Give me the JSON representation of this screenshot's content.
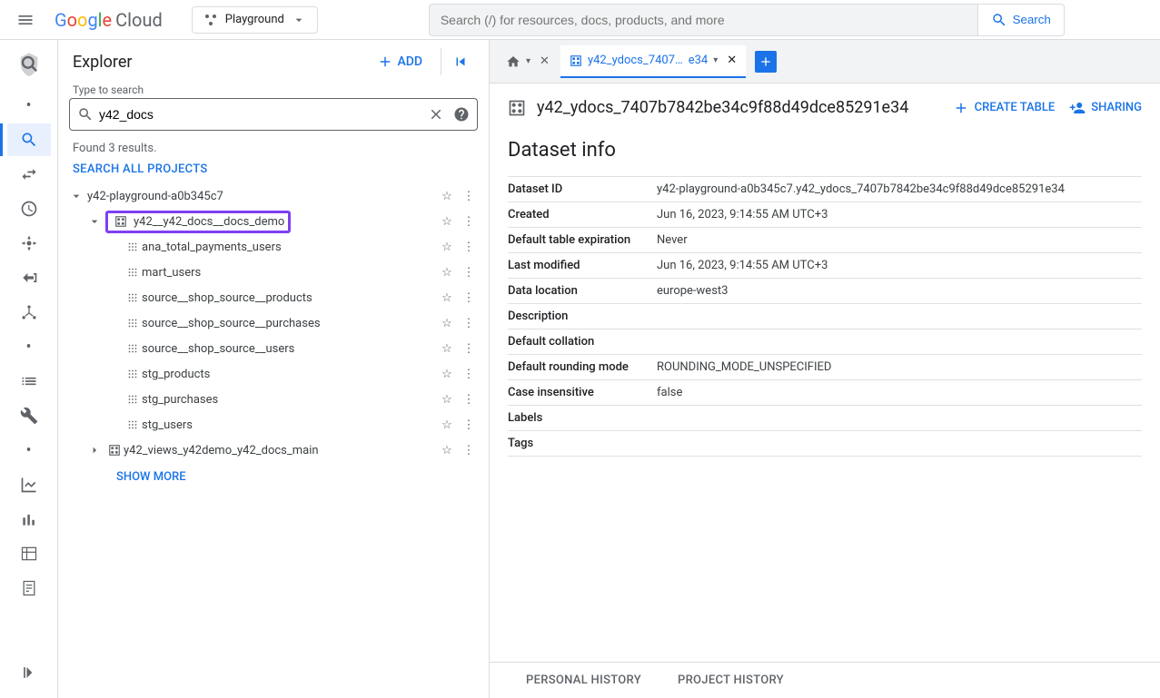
{
  "header": {
    "logo_google": "Google",
    "logo_cloud": "Cloud",
    "project_name": "Playground",
    "search_placeholder": "Search (/) for resources, docs, products, and more",
    "search_button": "Search"
  },
  "explorer": {
    "title": "Explorer",
    "add_button": "ADD",
    "search_label": "Type to search",
    "search_value": "y42_docs",
    "results_text": "Found 3 results.",
    "search_all": "SEARCH ALL PROJECTS",
    "show_more": "SHOW MORE",
    "tree": {
      "project": "y42-playground-a0b345c7",
      "dataset_highlighted": "y42__y42_docs__docs_demo",
      "tables": [
        "ana_total_payments_users",
        "mart_users",
        "source__shop_source__products",
        "source__shop_source__purchases",
        "source__shop_source__users",
        "stg_products",
        "stg_purchases",
        "stg_users"
      ],
      "dataset_collapsed": "y42_views_y42demo_y42_docs_main"
    }
  },
  "tabs": {
    "active_tab_label": "y42_ydocs_7407…",
    "active_tab_suffix": "e34"
  },
  "dataset": {
    "full_name": "y42_ydocs_7407b7842be34c9f88d49dce85291e34",
    "create_table": "CREATE TABLE",
    "sharing": "SHARING",
    "info_title": "Dataset info",
    "rows": [
      {
        "key": "Dataset ID",
        "val": "y42-playground-a0b345c7.y42_ydocs_7407b7842be34c9f88d49dce85291e34"
      },
      {
        "key": "Created",
        "val": "Jun 16, 2023, 9:14:55 AM UTC+3"
      },
      {
        "key": "Default table expiration",
        "val": "Never"
      },
      {
        "key": "Last modified",
        "val": "Jun 16, 2023, 9:14:55 AM UTC+3"
      },
      {
        "key": "Data location",
        "val": "europe-west3"
      },
      {
        "key": "Description",
        "val": ""
      },
      {
        "key": "Default collation",
        "val": ""
      },
      {
        "key": "Default rounding mode",
        "val": "ROUNDING_MODE_UNSPECIFIED"
      },
      {
        "key": "Case insensitive",
        "val": "false"
      },
      {
        "key": "Labels",
        "val": ""
      },
      {
        "key": "Tags",
        "val": ""
      }
    ]
  },
  "bottom_tabs": {
    "personal": "PERSONAL HISTORY",
    "project": "PROJECT HISTORY"
  }
}
